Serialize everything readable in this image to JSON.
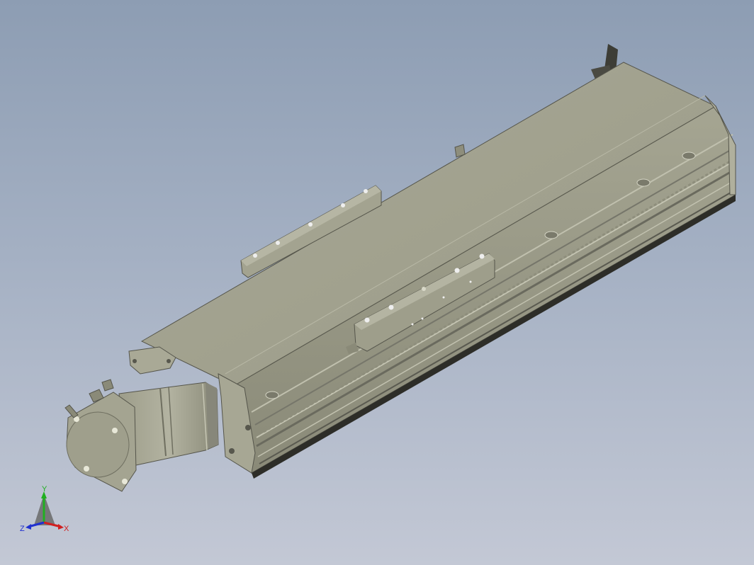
{
  "viewport": {
    "background_top": "#8d9db3",
    "background_bottom": "#c3c8d5"
  },
  "model": {
    "body_color": "#a4a490",
    "body_dark": "#6f6f5f",
    "body_light": "#b8b8a6"
  },
  "triad": {
    "x_label": "X",
    "y_label": "Y",
    "z_label": "Z",
    "x_color": "#d02020",
    "y_color": "#20b020",
    "z_color": "#2030d0"
  }
}
